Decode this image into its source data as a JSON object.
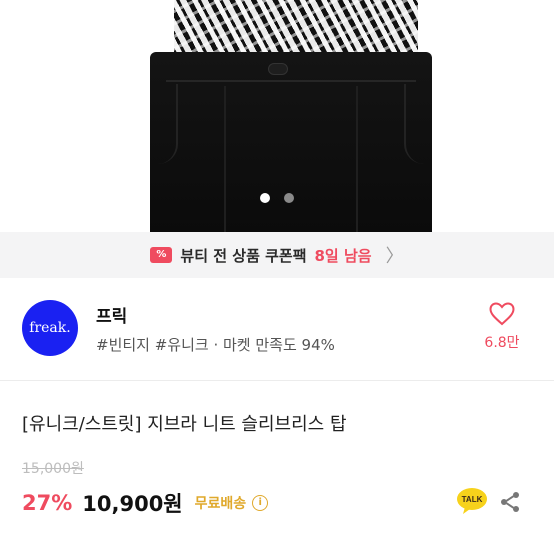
{
  "carousel": {
    "total": 2,
    "active_index": 1
  },
  "coupon": {
    "icon_text": "%",
    "text_main": "뷰티 전 상품 쿠폰팩",
    "text_highlight": "8일 남음",
    "chevron": "〉",
    "accent": "#ef4b5f"
  },
  "shop": {
    "logo_text": "freak.",
    "logo_color": "#1a21f2",
    "name": "프릭",
    "tags": "#빈티지 #유니크 · 마켓 만족도 94%",
    "likes": "6.8만"
  },
  "product": {
    "title": "[유니크/스트릿] 지브라 니트 슬리브리스 탑",
    "original_price": "15,000원",
    "discount": "27%",
    "price": "10,900원",
    "shipping": "무료배송",
    "info_icon": "i"
  },
  "actions": {
    "talk_label": "TALK"
  },
  "icons": {
    "heart": "heart-icon",
    "talk": "kakao-talk-icon",
    "share": "share-icon",
    "info": "info-icon"
  }
}
